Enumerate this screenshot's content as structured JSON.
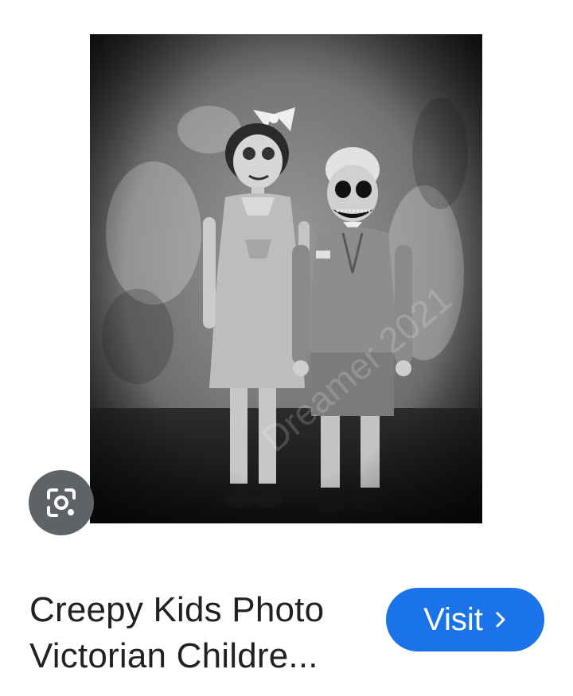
{
  "result": {
    "title_line1": "Creepy Kids Photo",
    "title_line2": "Victorian Childre...",
    "image_watermark": "Dreamer 2021"
  },
  "actions": {
    "visit_label": "Visit",
    "visit_icon": "chevron-right-icon",
    "lens_icon": "google-lens-icon"
  },
  "colors": {
    "visit_bg": "#1a73e8",
    "lens_bg": "#5f6368",
    "text": "#202124"
  }
}
